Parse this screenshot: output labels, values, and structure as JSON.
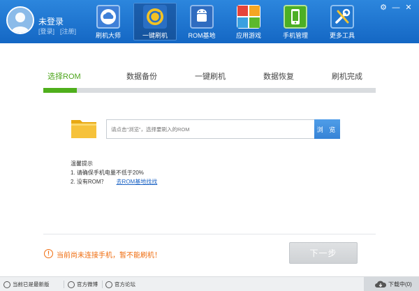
{
  "header": {
    "user": {
      "name": "未登录",
      "login": "[登录]",
      "register": "[注册]"
    },
    "nav": [
      {
        "label": "刷机大师",
        "icon": "cloud-icon",
        "color": "#3b7bd4"
      },
      {
        "label": "一键刷机",
        "icon": "refresh-icon",
        "color": "#f0b814"
      },
      {
        "label": "ROM基地",
        "icon": "android-icon",
        "color": "#3a78c8"
      },
      {
        "label": "应用游戏",
        "icon": "apps-grid-icon",
        "color": "#e5453a"
      },
      {
        "label": "手机管理",
        "icon": "phone-icon",
        "color": "#4caf24"
      },
      {
        "label": "更多工具",
        "icon": "tools-icon",
        "color": "#1f6fc9"
      }
    ],
    "active_nav": 1,
    "window_controls": [
      "⚙",
      "—",
      "✕"
    ]
  },
  "steps": {
    "items": [
      "选择ROM",
      "数据备份",
      "一键刷机",
      "数据恢复",
      "刷机完成"
    ],
    "active": 0,
    "progress": 0.1
  },
  "rom": {
    "placeholder": "请点击“浏览”，选择要刷入的ROM",
    "browse_label": "浏 览"
  },
  "tips": {
    "title": "温馨提示",
    "line1": "1. 请确保手机电量不低于20%",
    "line2": "2. 没有ROM？",
    "link": "去ROM基地找找"
  },
  "warning": {
    "text": "当前尚未连接手机，暂不能刷机！"
  },
  "next_button": {
    "label": "下一步"
  },
  "footer": {
    "version": "当前已是最新版",
    "weibo": "官方微博",
    "forum": "官方论坛",
    "downloading": "下载中(0)"
  },
  "colors": {
    "header": "#1a72cf",
    "active_step": "#4da51c",
    "warning": "#ef6c0e",
    "link": "#1a62c4",
    "browse_button": "#3a86d8"
  }
}
